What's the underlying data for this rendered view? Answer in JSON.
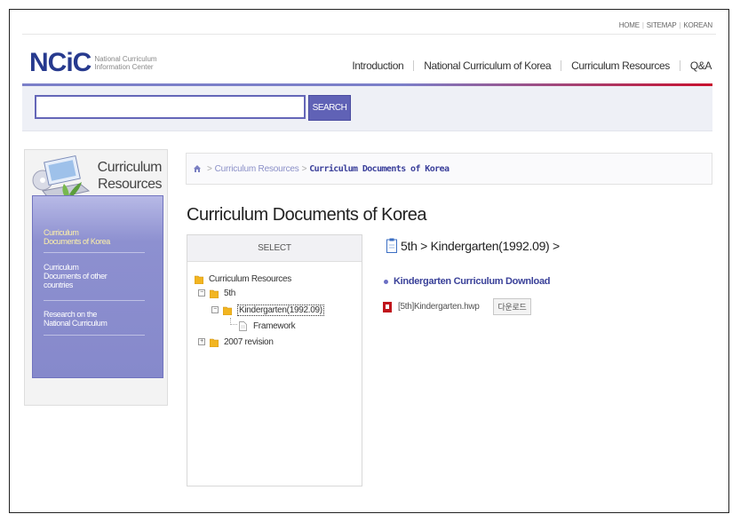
{
  "util_links": [
    "HOME",
    "SITEMAP",
    "KOREAN"
  ],
  "logo": {
    "mark": "NCiC",
    "line1": "National Curriculum",
    "line2": "Information Center"
  },
  "nav": {
    "items": [
      "Introduction",
      "National Curriculum of Korea",
      "Curriculum Resources",
      "Q&A"
    ]
  },
  "search": {
    "value": "",
    "button_label": "SEARCH"
  },
  "sidebar": {
    "title_line1": "Curriculum",
    "title_line2": "Resources",
    "items": [
      {
        "line1": "Curriculum",
        "line2": "Documents of Korea",
        "line3": "",
        "active": true
      },
      {
        "line1": "Curriculum",
        "line2": "Documents of other",
        "line3": "countries",
        "active": false
      },
      {
        "line1": "Research on the",
        "line2": "National Curriculum",
        "line3": "",
        "active": false
      }
    ]
  },
  "breadcrumb": {
    "parent": "Curriculum Resources",
    "current": "Curriculum Documents of Korea"
  },
  "page_title": "Curriculum Documents of Korea",
  "tree": {
    "header": "SELECT",
    "root": "Curriculum Resources",
    "node_5th": "5th",
    "node_kg": "Kindergarten(1992.09)",
    "node_framework": "Framework",
    "node_2007": "2007 revision"
  },
  "detail": {
    "path": "5th > Kindergarten(1992.09) >",
    "download_title": "Kindergarten Curriculum Download",
    "file_name": "[5th]Kindergarten.hwp",
    "download_button": "다운로드"
  },
  "colors": {
    "brand": "#273a8e",
    "accent": "#6062b6",
    "nav_red": "#c8102e"
  }
}
